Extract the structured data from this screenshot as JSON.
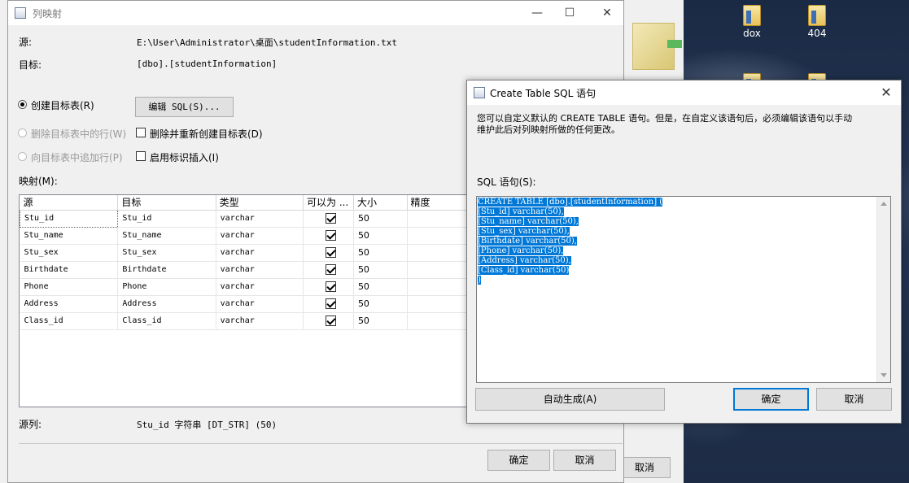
{
  "desktop": {
    "icons": [
      {
        "label": "dox"
      },
      {
        "label": "404"
      }
    ],
    "bg_cancel_label": "取消"
  },
  "main_window": {
    "title": "列映射",
    "source_label": "源:",
    "source_value": "E:\\User\\Administrator\\桌面\\studentInformation.txt",
    "target_label": "目标:",
    "target_value": "[dbo].[studentInformation]",
    "radio_create": "创建目标表(R)",
    "radio_delete_rows": "删除目标表中的行(W)",
    "radio_append_rows": "向目标表中追加行(P)",
    "edit_sql_button": "编辑 SQL(S)...",
    "check_drop_recreate": "删除并重新创建目标表(D)",
    "check_identity_insert": "启用标识插入(I)",
    "mapping_label": "映射(M):",
    "columns": [
      "源",
      "目标",
      "类型",
      "可以为 ...",
      "大小",
      "精度"
    ],
    "rows": [
      {
        "source": "Stu_id",
        "target": "Stu_id",
        "type": "varchar",
        "nullable": true,
        "size": "50"
      },
      {
        "source": "Stu_name",
        "target": "Stu_name",
        "type": "varchar",
        "nullable": true,
        "size": "50"
      },
      {
        "source": "Stu_sex",
        "target": "Stu_sex",
        "type": "varchar",
        "nullable": true,
        "size": "50"
      },
      {
        "source": "Birthdate",
        "target": "Birthdate",
        "type": "varchar",
        "nullable": true,
        "size": "50"
      },
      {
        "source": "Phone",
        "target": "Phone",
        "type": "varchar",
        "nullable": true,
        "size": "50"
      },
      {
        "source": "Address",
        "target": "Address",
        "type": "varchar",
        "nullable": true,
        "size": "50"
      },
      {
        "source": "Class_id",
        "target": "Class_id",
        "type": "varchar",
        "nullable": true,
        "size": "50"
      }
    ],
    "source_column_label": "源列:",
    "source_column_value": "Stu_id 字符串 [DT_STR] (50)",
    "ok_button": "确定",
    "cancel_button": "取消"
  },
  "sql_dialog": {
    "title": "Create Table SQL 语句",
    "description_line1": "您可以自定义默认的 CREATE TABLE 语句。但是，在自定义该语句后，必须编辑该语句以手动",
    "description_line2": "维护此后对列映射所做的任何更改。",
    "sql_label": "SQL 语句(S):",
    "sql_lines": [
      "CREATE TABLE [dbo].[studentInformation] (",
      "[Stu_id] varchar(50),",
      "[Stu_name] varchar(50),",
      "[Stu_sex] varchar(50),",
      "[Birthdate] varchar(50),",
      "[Phone] varchar(50),",
      "[Address] varchar(50),",
      "[Class_id] varchar(50)",
      ")"
    ],
    "auto_generate_button": "自动生成(A)",
    "ok_button": "确定",
    "cancel_button": "取消",
    "selection_color": "#0078d7"
  }
}
